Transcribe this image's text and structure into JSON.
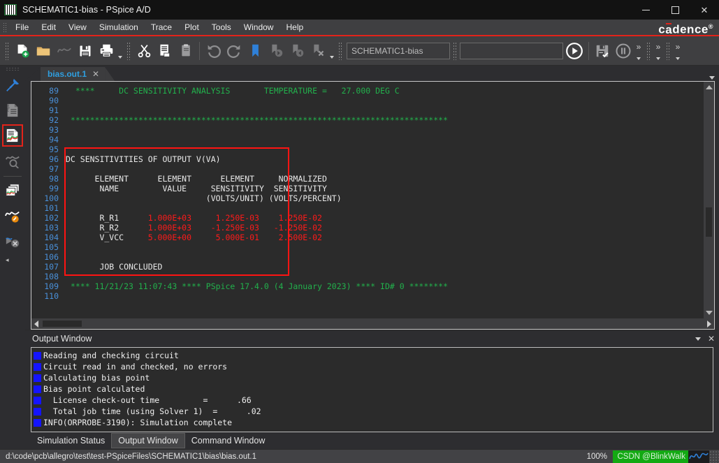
{
  "window": {
    "title": "SCHEMATIC1-bias - PSpice A/D",
    "icon": "pspice-app-icon",
    "minimize_label": "–",
    "maximize_label": "□",
    "close_label": "✕"
  },
  "brand": {
    "text_before": "c",
    "text_a": "a",
    "text_after": "dence",
    "superscript": "®"
  },
  "menu": {
    "items": [
      "File",
      "Edit",
      "View",
      "Simulation",
      "Trace",
      "Plot",
      "Tools",
      "Window",
      "Help"
    ]
  },
  "toolbar": {
    "group1": [
      "new-file-icon",
      "open-folder-icon",
      "waveform-icon",
      "save-icon",
      "print-icon"
    ],
    "group2": [
      "cut-icon",
      "copy-icon",
      "paste-icon"
    ],
    "group3": [
      "undo-icon",
      "redo-icon",
      "bookmark-icon",
      "bookmark-next-icon",
      "bookmark-prev-icon",
      "bookmark-clear-icon"
    ],
    "profile_field": "SCHEMATIC1-bias",
    "search_field": "",
    "run_icon": "run-simulation-icon",
    "check_icon": "save-check-icon",
    "pause_icon": "pause-simulation-icon",
    "overflow_label": "»"
  },
  "leftdock": {
    "items": [
      {
        "name": "pin-panel-icon",
        "active": false
      },
      {
        "name": "pspice-file-icon",
        "active": false
      },
      {
        "name": "output-file-icon",
        "active": true
      },
      {
        "name": "waveform-search-icon",
        "active": false
      },
      {
        "name": "windows-stack-icon",
        "active": false
      },
      {
        "name": "waveform-marker-icon",
        "active": false
      },
      {
        "name": "waveform-tools-icon",
        "active": false
      }
    ],
    "collapse_arrow": "◂"
  },
  "tabs": {
    "active": "bias.out.1",
    "close_label": "✕"
  },
  "editor": {
    "first_line_number": 89,
    "lines": [
      {
        "n": 89,
        "segments": [
          {
            "t": "  ****     DC SENSITIVITY ANALYSIS       TEMPERATURE =   27.000 DEG C",
            "c": "g"
          }
        ]
      },
      {
        "n": 90,
        "segments": [
          {
            "t": "",
            "c": "w"
          }
        ]
      },
      {
        "n": 91,
        "segments": [
          {
            "t": "",
            "c": "w"
          }
        ]
      },
      {
        "n": 92,
        "segments": [
          {
            "t": " ******************************************************************************",
            "c": "g"
          }
        ]
      },
      {
        "n": 93,
        "segments": [
          {
            "t": "",
            "c": "w"
          }
        ]
      },
      {
        "n": 94,
        "segments": [
          {
            "t": "",
            "c": "w"
          }
        ]
      },
      {
        "n": 95,
        "segments": [
          {
            "t": "",
            "c": "w"
          }
        ]
      },
      {
        "n": 96,
        "segments": [
          {
            "t": "DC SENSITIVITIES OF OUTPUT V(VA)",
            "c": "w"
          }
        ]
      },
      {
        "n": 97,
        "segments": [
          {
            "t": "",
            "c": "w"
          }
        ]
      },
      {
        "n": 98,
        "segments": [
          {
            "t": "      ELEMENT      ELEMENT      ELEMENT     NORMALIZED",
            "c": "w"
          }
        ]
      },
      {
        "n": 99,
        "segments": [
          {
            "t": "       NAME         VALUE     SENSITIVITY  SENSITIVITY",
            "c": "w"
          }
        ]
      },
      {
        "n": 100,
        "segments": [
          {
            "t": "                             (VOLTS/UNIT) (VOLTS/PERCENT)",
            "c": "w"
          }
        ]
      },
      {
        "n": 101,
        "segments": [
          {
            "t": "",
            "c": "w"
          }
        ]
      },
      {
        "n": 102,
        "segments": [
          {
            "t": "       R_R1      ",
            "c": "w"
          },
          {
            "t": "1.000E+03     1.250E-03    1.250E-02",
            "c": "r"
          }
        ]
      },
      {
        "n": 103,
        "segments": [
          {
            "t": "       R_R2      ",
            "c": "w"
          },
          {
            "t": "1.000E+03    -1.250E-03   -1.250E-02",
            "c": "r"
          }
        ]
      },
      {
        "n": 104,
        "segments": [
          {
            "t": "       V_VCC     ",
            "c": "w"
          },
          {
            "t": "5.000E+00     5.000E-01    2.500E-02",
            "c": "r"
          }
        ]
      },
      {
        "n": 105,
        "segments": [
          {
            "t": "",
            "c": "w"
          }
        ]
      },
      {
        "n": 106,
        "segments": [
          {
            "t": "",
            "c": "w"
          }
        ]
      },
      {
        "n": 107,
        "segments": [
          {
            "t": "       JOB CONCLUDED",
            "c": "w"
          }
        ]
      },
      {
        "n": 108,
        "segments": [
          {
            "t": "",
            "c": "w"
          }
        ]
      },
      {
        "n": 109,
        "segments": [
          {
            "t": " **** 11/21/23 11:07:43 **** PSpice 17.4.0 (4 January 2023) **** ID# 0 ********",
            "c": "g"
          }
        ]
      },
      {
        "n": 110,
        "segments": [
          {
            "t": "",
            "c": "w"
          }
        ]
      }
    ],
    "annotation": {
      "color": "#ff1412",
      "label": "sensitivity-results-highlight"
    }
  },
  "output_panel": {
    "title": "Output Window",
    "collapse_label": "▾",
    "close_label": "✕",
    "messages": [
      "Reading and checking circuit",
      "Circuit read in and checked, no errors",
      "Calculating bias point",
      "Bias point calculated",
      "  License check-out time         =      .66",
      "  Total job time (using Solver 1)  =      .02",
      "INFO(ORPROBE-3190): Simulation complete"
    ],
    "bullet_color": "#1414ff"
  },
  "bottom_tabs": {
    "items": [
      "Simulation Status",
      "Output Window",
      "Command Window"
    ],
    "active": "Output Window"
  },
  "statusbar": {
    "path": "d:\\code\\pcb\\allegro\\test\\test-PSpiceFiles\\SCHEMATIC1\\bias\\bias.out.1",
    "zoom": "100%",
    "watermark": "CSDN @BlinkWalk",
    "watermark_bg": "#13a913"
  }
}
